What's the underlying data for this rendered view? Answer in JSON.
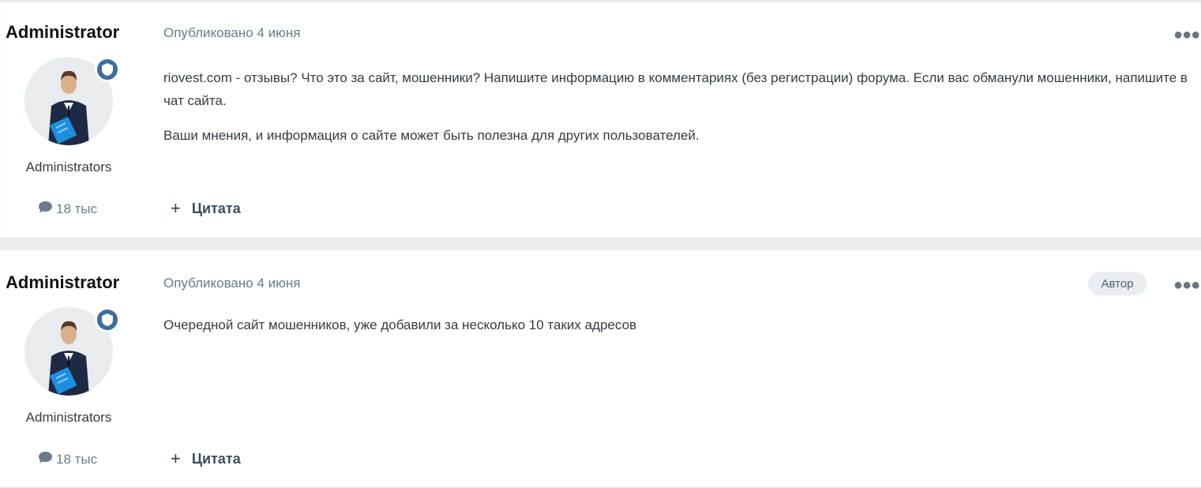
{
  "posts": [
    {
      "author": "Administrator",
      "group": "Administrators",
      "posts_count": "18 тыс",
      "published": "Опубликовано 4 июня",
      "author_badge": "",
      "paragraphs": [
        "riovest.com - отзывы? Что это за сайт, мошенники? Напишите информацию в комментариях (без регистрации) форума. Если вас обманули мошенники, напишите в чат сайта.",
        "Ваши мнения, и информация о сайте может быть полезна для других пользователей."
      ],
      "quote_label": "Цитата"
    },
    {
      "author": "Administrator",
      "group": "Administrators",
      "posts_count": "18 тыс",
      "published": "Опубликовано 4 июня",
      "author_badge": "Автор",
      "paragraphs": [
        "Очередной сайт мошенников, уже добавили за несколько 10 таких адресов"
      ],
      "quote_label": "Цитата"
    }
  ],
  "colors": {
    "badge": "#3b6d9e",
    "meta_text": "#6a7a8a",
    "page_bg": "#ebedf0"
  },
  "icons": {
    "badge": "shield-icon",
    "count": "speech-bubble-icon",
    "menu": "ellipsis-icon",
    "quote": "plus-icon"
  }
}
